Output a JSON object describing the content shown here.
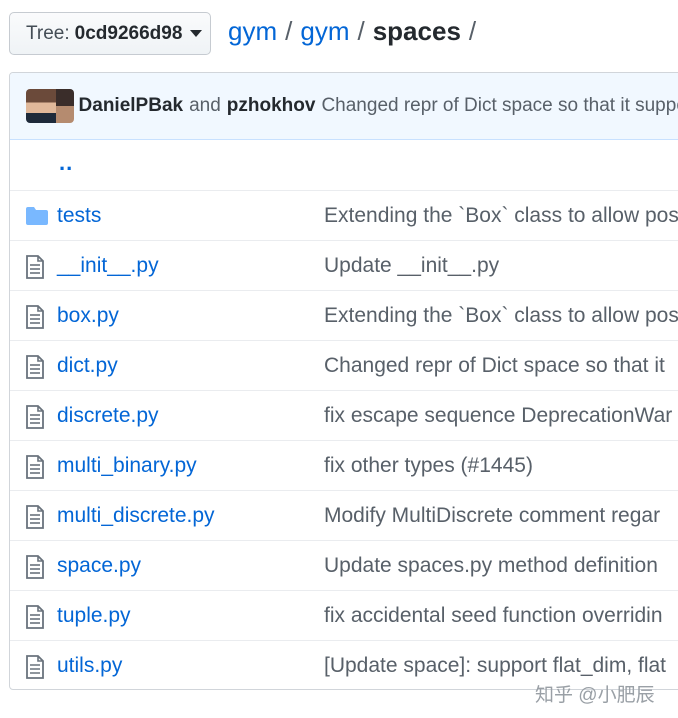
{
  "tree": {
    "label": "Tree:",
    "ref": "0cd9266d98"
  },
  "breadcrumb": {
    "repo": "gym",
    "folder1": "gym",
    "current": "spaces",
    "sep": "/"
  },
  "commit": {
    "author1": "DanielPBak",
    "and": "and",
    "author2": "pzhokhov",
    "message": "Changed repr of Dict space so that it supports"
  },
  "up_dir": "..",
  "files": [
    {
      "name": "tests",
      "type": "folder",
      "message": "Extending the `Box` class to allow pos"
    },
    {
      "name": "__init__.py",
      "type": "file",
      "message": "Update __init__.py"
    },
    {
      "name": "box.py",
      "type": "file",
      "message": "Extending the `Box` class to allow pos"
    },
    {
      "name": "dict.py",
      "type": "file",
      "message": "Changed repr of Dict space so that it"
    },
    {
      "name": "discrete.py",
      "type": "file",
      "message": "fix escape sequence DeprecationWar"
    },
    {
      "name": "multi_binary.py",
      "type": "file",
      "message": "fix other types (#1445)"
    },
    {
      "name": "multi_discrete.py",
      "type": "file",
      "message": "Modify MultiDiscrete comment regar"
    },
    {
      "name": "space.py",
      "type": "file",
      "message": "Update spaces.py method definition"
    },
    {
      "name": "tuple.py",
      "type": "file",
      "message": "fix accidental seed function overridin"
    },
    {
      "name": "utils.py",
      "type": "file",
      "message": "[Update space]: support flat_dim, flat"
    }
  ],
  "watermark": "知乎 @小肥辰",
  "colors": {
    "link": "#0366d6",
    "folder": "#79b8ff",
    "file": "#6a737d",
    "commit_bg": "#f1f8ff"
  }
}
